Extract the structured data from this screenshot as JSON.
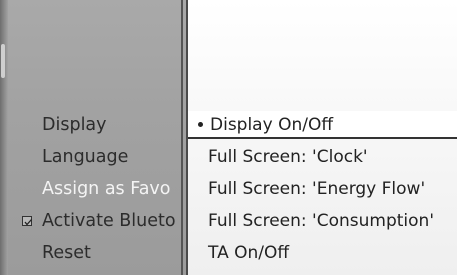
{
  "left_menu": {
    "items": [
      {
        "label": "Display",
        "state": "normal"
      },
      {
        "label": "Language",
        "state": "normal"
      },
      {
        "label": "Assign as Favo",
        "state": "highlighted"
      },
      {
        "label": "Activate Blueto",
        "state": "checkable",
        "icon": "checkbox-checked-icon"
      },
      {
        "label": "Reset",
        "state": "normal"
      }
    ]
  },
  "right_menu": {
    "items": [
      {
        "label": "Display On/Off",
        "icon": "bullet-icon",
        "selected": true
      },
      {
        "label": "Full Screen: 'Clock'"
      },
      {
        "label": "Full Screen: 'Energy Flow'"
      },
      {
        "label": "Full Screen: 'Consumption'"
      },
      {
        "label": "TA On/Off"
      }
    ]
  },
  "colors": {
    "left_panel_bg": "#a4a4a4",
    "highlight_text": "#f4f4f4",
    "right_panel_bg": "#f8f8f8",
    "text_dark": "#222222"
  }
}
